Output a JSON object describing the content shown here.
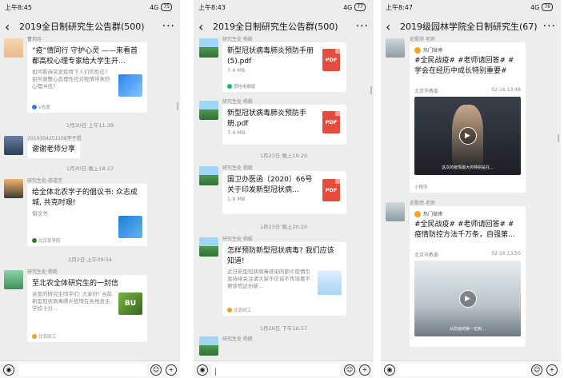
{
  "screens": [
    {
      "status": {
        "time": "上午8:45",
        "network": "4G",
        "battery": "75"
      },
      "title": "2019全日制研究生公告群(500)",
      "messages": {
        "m1_sender": "曹玥月",
        "m1_title": "“疫”情同行 守护心灵 ——来看首都高校心理专家给大学生开...",
        "m1_desc": "如何看待突发疫情下人们的反应? 如何调整心态理性应对疫情带来的心理冲击?",
        "m1_src": "V态度",
        "t1": "1月30日 上午11:39",
        "m2_sender": "2019304251108李子煜",
        "m2_text": "谢谢老师分享",
        "t2": "1月30日 晚上18:27",
        "m3_sender": "研究生处-邵道芳",
        "m3_title": "给全体北农学子的倡议书: 众志成城, 共克时艰!",
        "m3_desc": "倡议书",
        "m3_src": "北京农学院",
        "t3": "2月2日 上午09:54",
        "m4_sender": "研究生处 杨毅",
        "m4_title": "至北农全体研究生的一封信",
        "m4_desc": "亲爱的研究生同学们: 大家好! 当前, 新型冠状病毒肺炎疫情在各地发生, 学校十分...",
        "m4_thumb": "BU",
        "m4_src": "北农研工"
      },
      "input_placeholder": ""
    },
    {
      "status": {
        "time": "上午8:43",
        "network": "4G",
        "battery": "77"
      },
      "title": "2019全日制研究生公告群(500)",
      "messages": {
        "sender": "研究生处 杨毅",
        "f1_name": "新型冠状病毒肺炎预防手册(5).pdf",
        "f1_size": "7.4 MB",
        "f1_src": "慧信电脑版",
        "f2_name": "新型冠状病毒肺炎预防手册.pdf",
        "f2_size": "7.4 MB",
        "t1": "1月23日 晚上19:20",
        "f3_name": "国卫办医函〔2020〕66号关于印发新型冠状病...",
        "f3_size": "1.9 MB",
        "t2": "1月23日 晚上20:20",
        "a_title": "怎样预防新型冠状病毒? 我们应该知道!",
        "a_desc": "近日新型冠状病毒感染的肺炎疫情引发持续关注请大家不信谣不传谣要不要惊慌这份新...",
        "a_src": "北农研工",
        "t3": "1月26日 下午16:57",
        "pdf_label": "PDF"
      },
      "input_placeholder": ""
    },
    {
      "status": {
        "time": "上午8:47",
        "network": "4G",
        "battery": "76"
      },
      "title": "2019级园林学院全日制研究生(67)",
      "messages": {
        "sender": "史歌然 老师",
        "hot_label": "热门微博",
        "w1_text": "#全民战疫# #老师请回答# #学会在经历中成长特别重要#",
        "w1_account": "北京市教委",
        "w1_time": "02-16 13:48",
        "w1_caption": "这次的疫情最大的特别是在...",
        "w2_text": "#全民战疫# #老师请回答# #疫情防控方法千万条，自强第...",
        "w2_account": "北京市教委",
        "w2_time": "02-16 13:50",
        "w2_caption": "从防疫的第一位到...",
        "mini_label": "小程序"
      },
      "input_placeholder": ""
    }
  ],
  "icons": {
    "back": "back-chevron-icon",
    "more": "more-dots-icon",
    "voice": "voice-icon",
    "emoji": "emoji-icon",
    "plus": "plus-icon"
  },
  "colors": {
    "background": "#ededed",
    "pdf": "#e54c3c",
    "accent": "#07c160"
  }
}
